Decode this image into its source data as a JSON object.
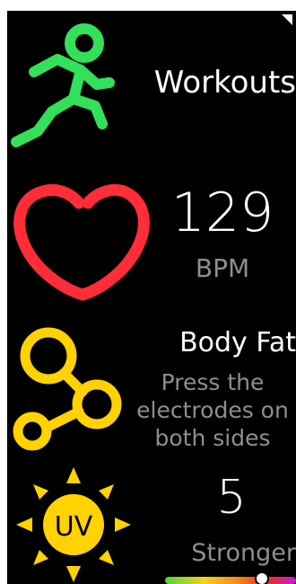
{
  "screen": {
    "bg_color": "#000000"
  },
  "workouts": {
    "label": "Workouts",
    "icon": "running-person-icon",
    "color": "#33e05a"
  },
  "heart_rate": {
    "value": "129",
    "unit": "BPM",
    "icon": "heart-icon",
    "color": "#ff2d38"
  },
  "body_fat": {
    "title": "Body Fat",
    "hint": "Press the electrodes on both sides",
    "icon": "molecule-icon",
    "color": "#ffd200"
  },
  "uv": {
    "value": "5",
    "level": "Stronger",
    "icon_text": "UV",
    "icon": "sun-uv-icon",
    "color": "#ffd200",
    "indicator_level": 0.74
  }
}
